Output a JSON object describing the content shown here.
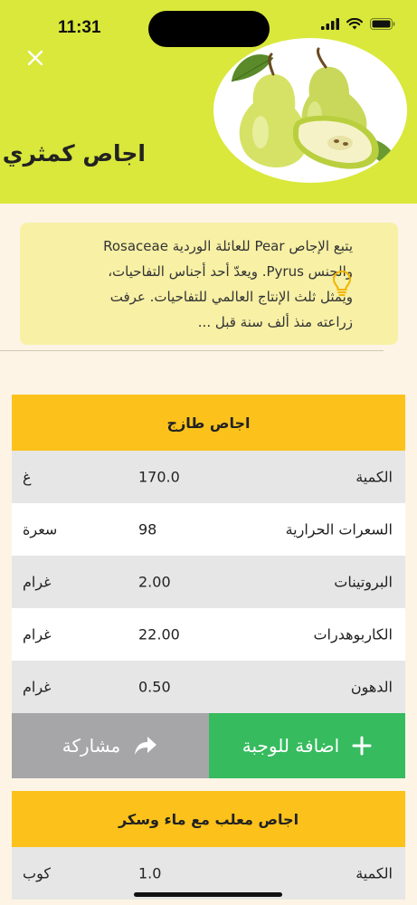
{
  "status_bar": {
    "time": "11:31"
  },
  "header": {
    "title": "اجاص كمثري"
  },
  "info": {
    "lines": [
      "يتبع الإجاص Pear للعائلة الوردية Rosaceae",
      "والجنس Pyrus. ويعدّ أحد أجناس التفاحيات،",
      "ويمثل ثلث الإنتاج العالمي للتفاحيات. عرفت",
      "زراعته منذ ألف سنة قبل ..."
    ]
  },
  "cards": [
    {
      "title": "اجاص طازج",
      "rows": [
        {
          "label": "الكمية",
          "value": "170.0",
          "unit": "غ"
        },
        {
          "label": "السعرات الحرارية",
          "value": "98",
          "unit": "سعرة"
        },
        {
          "label": "البروتينات",
          "value": "2.00",
          "unit": "غرام"
        },
        {
          "label": "الكاربوهدرات",
          "value": "22.00",
          "unit": "غرام"
        },
        {
          "label": "الدهون",
          "value": "0.50",
          "unit": "غرام"
        }
      ],
      "share_label": "مشاركة",
      "add_label": "اضافة للوجبة"
    },
    {
      "title": "اجاص معلب مع ماء وسكر",
      "rows": [
        {
          "label": "الكمية",
          "value": "1.0",
          "unit": "كوب"
        }
      ]
    }
  ],
  "icons": {
    "close": "close-icon",
    "bulb": "lightbulb-icon",
    "share": "share-arrow-icon",
    "add": "plus-icon"
  },
  "colors": {
    "header_bg": "#d9e83a",
    "card_head": "#fcc21b",
    "add_button": "#36bb5e",
    "share_button": "#a6a6a8",
    "info_bg": "#f7f0a5"
  }
}
